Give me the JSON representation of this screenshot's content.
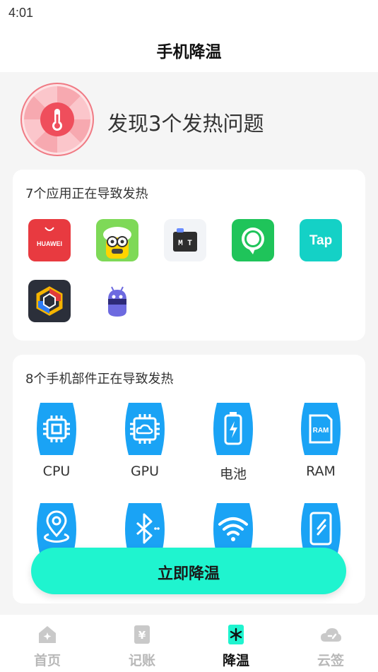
{
  "status": {
    "time": "4:01"
  },
  "header": {
    "title": "手机降温"
  },
  "hero": {
    "text": "发现3个发热问题",
    "icon": "overheating-fan-thermometer-icon"
  },
  "apps_card": {
    "title": "7个应用正在导致发热",
    "apps": [
      {
        "name": "Huawei AppGallery",
        "icon_text": "HUAWEI",
        "color": "#e83a40"
      },
      {
        "name": "Game app",
        "icon_text": "",
        "color": "#7ed957"
      },
      {
        "name": "MT Manager",
        "icon_text": "M T",
        "color": "#2e2e2e"
      },
      {
        "name": "Chat bubble app",
        "icon_text": "",
        "color": "#1fc45a"
      },
      {
        "name": "TapTap",
        "icon_text": "Tap",
        "color": "#14d1c6"
      },
      {
        "name": "Shield app",
        "icon_text": "",
        "color": "#2b2f3a"
      },
      {
        "name": "Android robot app",
        "icon_text": "",
        "color": "#6d6ae0"
      }
    ]
  },
  "parts_card": {
    "title": "8个手机部件正在导致发热",
    "parts": [
      {
        "label": "CPU",
        "icon": "cpu-chip-icon"
      },
      {
        "label": "GPU",
        "icon": "gpu-cloud-chip-icon"
      },
      {
        "label": "电池",
        "icon": "battery-charging-icon"
      },
      {
        "label": "RAM",
        "icon": "ram-card-icon",
        "icon_text": "RAM"
      },
      {
        "label": "",
        "icon": "location-pin-icon"
      },
      {
        "label": "",
        "icon": "bluetooth-icon"
      },
      {
        "label": "",
        "icon": "wifi-icon"
      },
      {
        "label": "",
        "icon": "phone-screen-icon"
      }
    ]
  },
  "cool_button": {
    "label": "立即降温"
  },
  "tabbar": {
    "tabs": [
      {
        "label": "首页",
        "icon": "home-sparkle-icon",
        "active": false
      },
      {
        "label": "记账",
        "icon": "yuan-ledger-icon",
        "active": false
      },
      {
        "label": "降温",
        "icon": "cooling-snowflake-icon",
        "active": true
      },
      {
        "label": "云签",
        "icon": "cloud-sign-icon",
        "active": false
      }
    ]
  },
  "colors": {
    "accent": "#1ff4cf",
    "part_blue": "#1aa3f5",
    "hero_red": "#ef4e5c"
  }
}
